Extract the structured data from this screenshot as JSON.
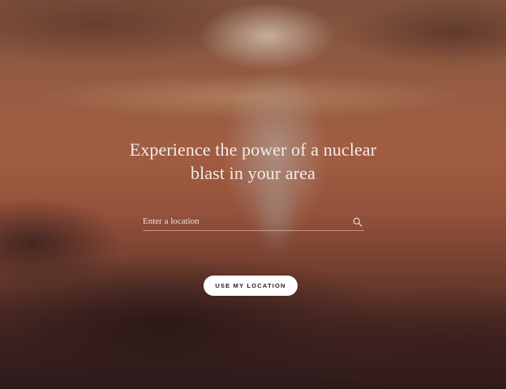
{
  "hero": {
    "headline_line1": "Experience the power of a nuclear",
    "headline_line2": "blast in your area"
  },
  "search": {
    "placeholder": "Enter a location",
    "value": "",
    "icon": "search-icon"
  },
  "actions": {
    "use_location_label": "USE MY LOCATION"
  },
  "colors": {
    "text": "#f4ece6",
    "button_bg": "#ffffff",
    "button_text": "#2a1a1a",
    "background_tone": "#a7674a"
  }
}
